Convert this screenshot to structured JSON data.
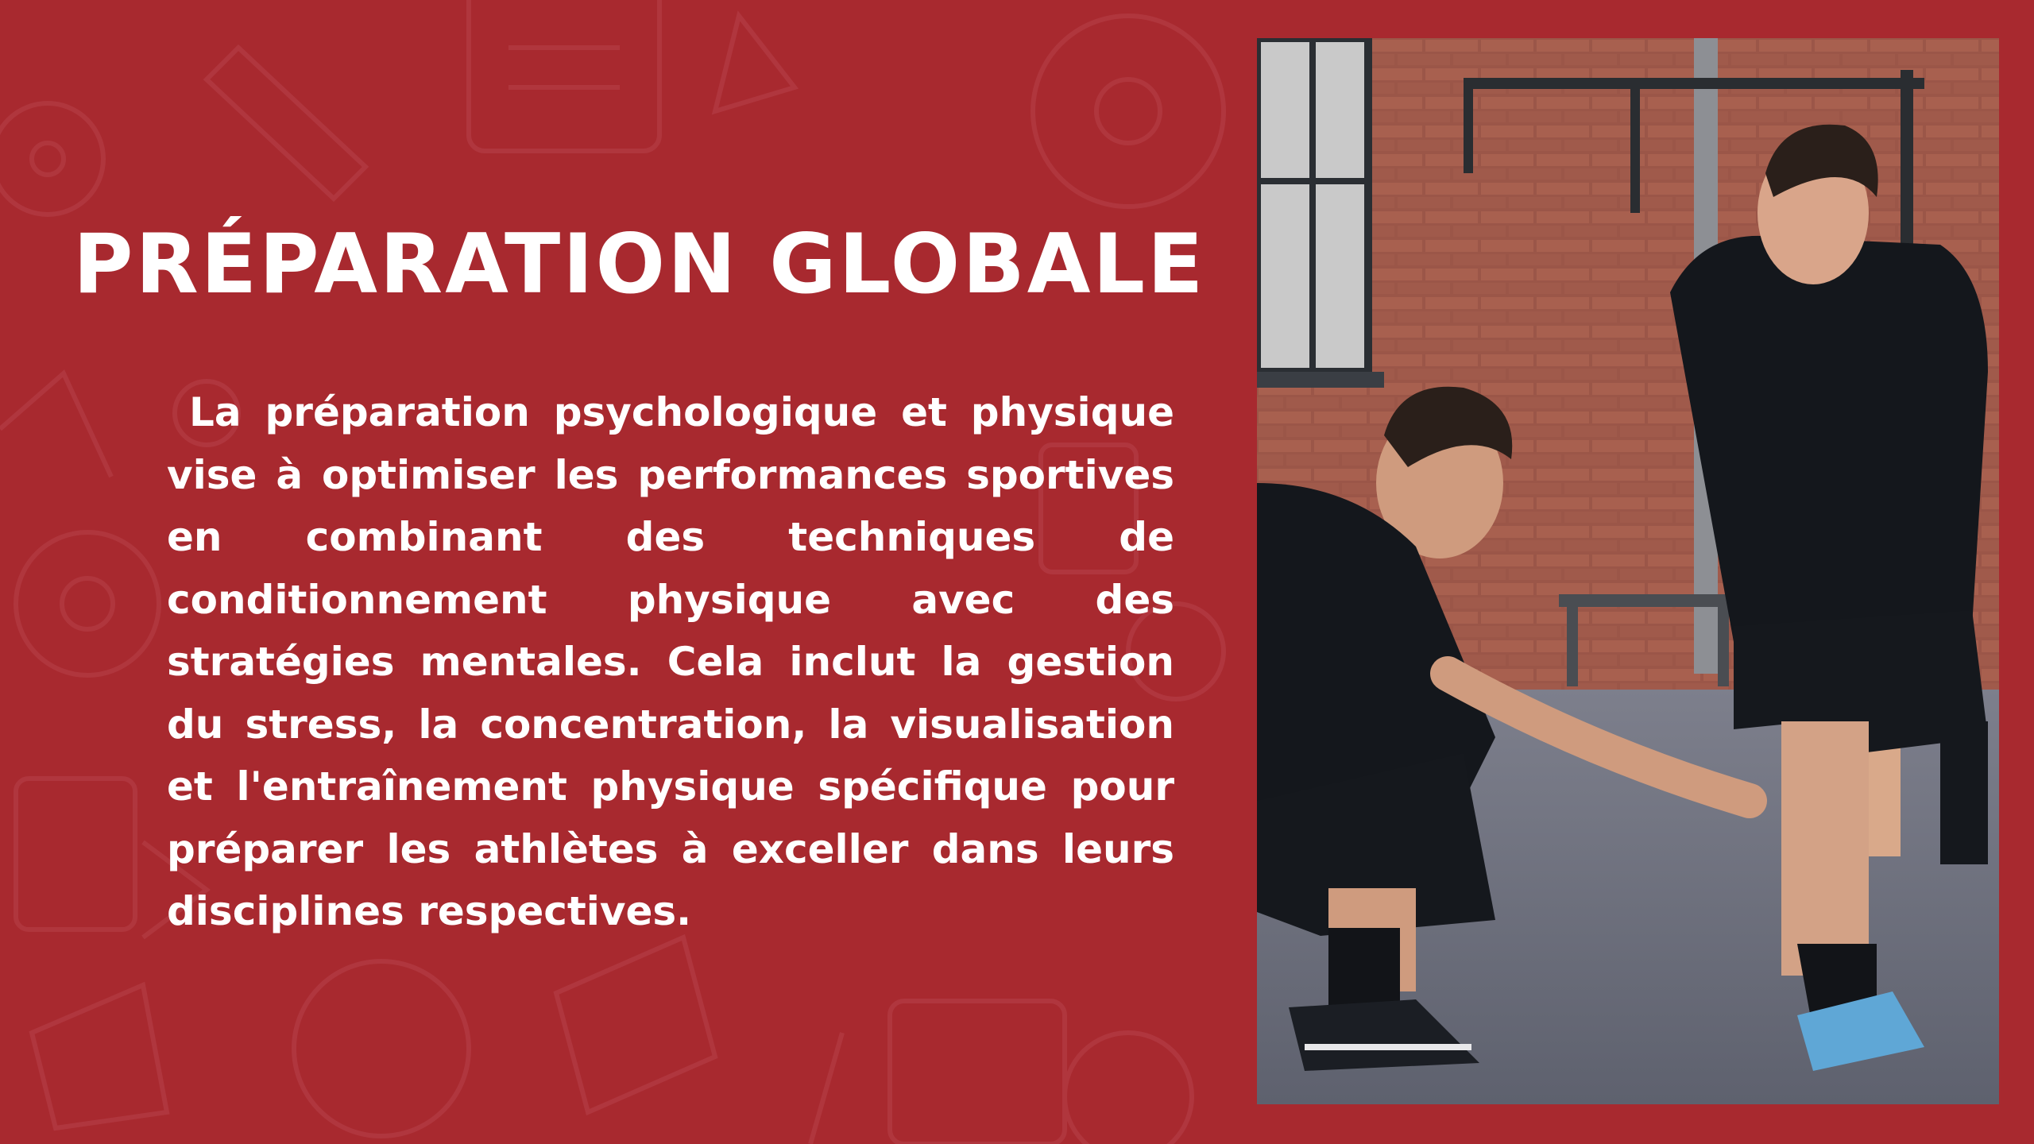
{
  "slide": {
    "title": "PRÉPARATION GLOBALE",
    "body": "La préparation psychologique et physique vise à optimiser les performances sportives en combinant des techniques de conditionnement physique avec des stratégies mentales. Cela inclut la gestion du stress, la concentration, la visualisation et l'entraînement physique spécifique pour préparer les athlètes à exceller dans leurs disciplines respectives."
  },
  "colors": {
    "background": "#a8292f",
    "text": "#ffffff"
  },
  "photo": {
    "icon": "coach-athlete-photo"
  }
}
